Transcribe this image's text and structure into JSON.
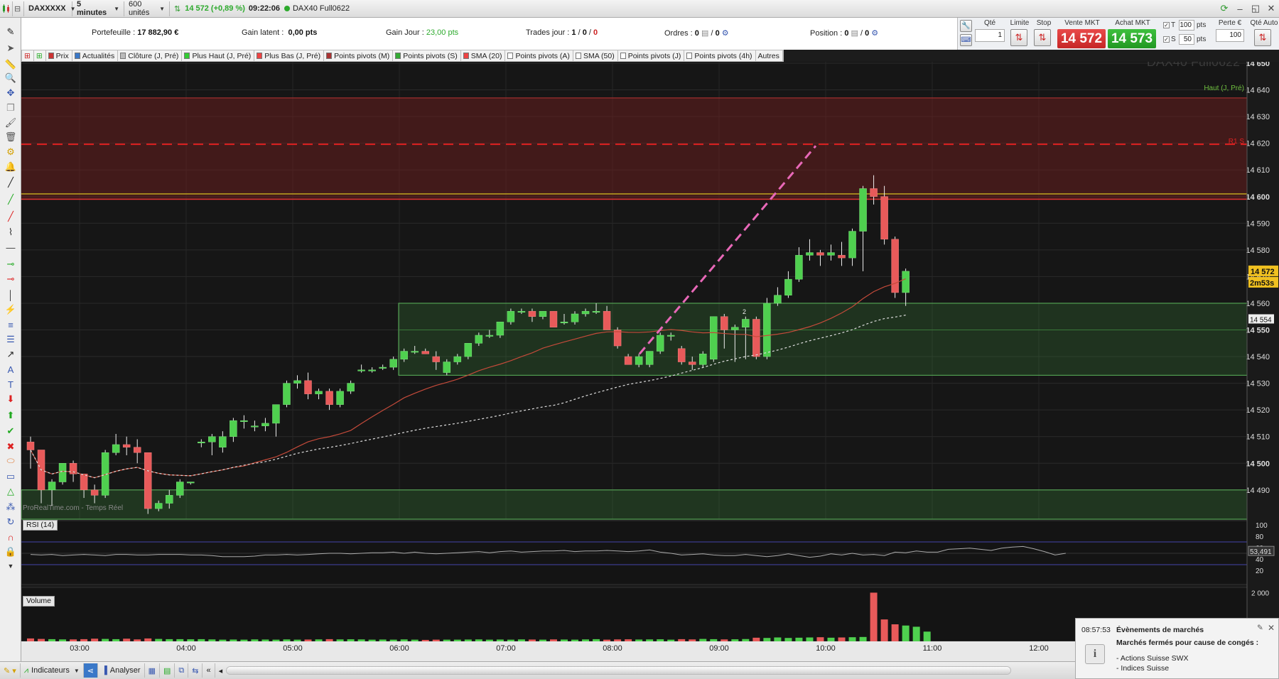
{
  "titlebar": {
    "instrument": "DAXXXXX",
    "timeframe": "5 minutes",
    "units": "600 unités",
    "price_change": "14 572 (+0,89 %)",
    "time": "09:22:06",
    "contract": "DAX40 Full0622"
  },
  "info": {
    "portfolio_label": "Portefeuille :",
    "portfolio_value": "17 882,90 €",
    "latent_label": "Gain latent :",
    "latent_value": "0,00 pts",
    "day_label": "Gain Jour :",
    "day_value": "23,00 pts",
    "trades_label": "Trades jour :",
    "trades_1": "1",
    "trades_2": "0",
    "trades_3": "0",
    "orders_label": "Ordres :",
    "orders_1": "0",
    "orders_2": "0",
    "position_label": "Position :",
    "position_1": "0",
    "position_2": "0"
  },
  "order_panel": {
    "qty_label": "Qté",
    "qty_value": "1",
    "limit_label": "Limite",
    "stop_label": "Stop",
    "sell_label": "Vente MKT",
    "sell_price": "14 572",
    "buy_label": "Achat MKT",
    "buy_price": "14 573",
    "t_label": "T",
    "t_value": "100",
    "s_label": "S",
    "s_value": "50",
    "pts": "pts",
    "loss_label": "Perte €",
    "loss_value": "100",
    "auto_label": "Qté Auto"
  },
  "indicators": [
    "Prix",
    "Actualités",
    "Clôture (J, Pré)",
    "Plus Haut (J, Pré)",
    "Plus Bas (J, Pré)",
    "Points pivots (M)",
    "Points pivots (S)",
    "SMA (20)",
    "Points pivots (A)",
    "SMA (50)",
    "Points pivots (J)",
    "Points pivots (4h)",
    "Autres"
  ],
  "chart": {
    "watermark": "DAX40 Full0622",
    "source": "ProRealTime.com - Temps Réel",
    "high_label": "Haut (J, Pré)",
    "r1_label": "R1 S",
    "price_tag": "14 572",
    "countdown": "2m53s",
    "sma_tag": "14 554",
    "rsi_label": "RSI (14)",
    "rsi_value": "53,491",
    "volume_label": "Volume",
    "marker": "2"
  },
  "chart_data": {
    "type": "candlestick",
    "x_tick_labels": [
      "03:00",
      "04:00",
      "05:00",
      "06:00",
      "07:00",
      "08:00",
      "09:00",
      "10:00",
      "11:00",
      "12:00"
    ],
    "y_tick_labels": [
      "14 650",
      "14 640",
      "14 630",
      "14 620",
      "14 610",
      "14 600",
      "14 590",
      "14 580",
      "14 570",
      "14 560",
      "14 550",
      "14 540",
      "14 530",
      "14 520",
      "14 510",
      "14 500",
      "14 490"
    ],
    "ylim": [
      14483,
      14655
    ],
    "rsi_tick_labels": [
      "100",
      "80",
      "60",
      "40",
      "20"
    ],
    "volume_tick_labels": [
      "2 000"
    ],
    "candles": [
      [
        14508,
        14510,
        14498,
        14505
      ],
      [
        14505,
        14505,
        14485,
        14490
      ],
      [
        14490,
        14494,
        14484,
        14493
      ],
      [
        14493,
        14500,
        14492,
        14500
      ],
      [
        14500,
        14501,
        14493,
        14496
      ],
      [
        14496,
        14496,
        14487,
        14490
      ],
      [
        14490,
        14492,
        14485,
        14488
      ],
      [
        14488,
        14505,
        14487,
        14504
      ],
      [
        14504,
        14511,
        14503,
        14507
      ],
      [
        14507,
        14510,
        14503,
        14506
      ],
      [
        14506,
        14509,
        14500,
        14504
      ],
      [
        14504,
        14504,
        14481,
        14483
      ],
      [
        14483,
        14486,
        14482,
        14485
      ],
      [
        14485,
        14490,
        14483,
        14488
      ],
      [
        14488,
        14494,
        14487,
        14493
      ],
      [
        14493,
        14493,
        14492,
        14493
      ],
      [
        14508,
        14509,
        14506,
        14508
      ],
      [
        14508,
        14511,
        14503,
        14510
      ],
      [
        14506,
        14512,
        14504,
        14510
      ],
      [
        14510,
        14517,
        14508,
        14516
      ],
      [
        14516,
        14518,
        14513,
        14516
      ],
      [
        14514,
        14516,
        14512,
        14514
      ],
      [
        14514,
        14517,
        14512,
        14515
      ],
      [
        14515,
        14522,
        14510,
        14522
      ],
      [
        14522,
        14531,
        14521,
        14530
      ],
      [
        14530,
        14533,
        14528,
        14531
      ],
      [
        14531,
        14534,
        14524,
        14526
      ],
      [
        14526,
        14528,
        14524,
        14527
      ],
      [
        14527,
        14528,
        14520,
        14522
      ],
      [
        14522,
        14528,
        14521,
        14527
      ],
      [
        14527,
        14531,
        14526,
        14530
      ],
      [
        14535,
        14537,
        14534,
        14535
      ],
      [
        14535,
        14536,
        14534,
        14535
      ],
      [
        14536,
        14537,
        14535,
        14536
      ],
      [
        14536,
        14540,
        14535,
        14539
      ],
      [
        14539,
        14543,
        14538,
        14542
      ],
      [
        14542,
        14544,
        14541,
        14542
      ],
      [
        14542,
        14543,
        14541,
        14541
      ],
      [
        14540,
        14542,
        14535,
        14538
      ],
      [
        14534,
        14539,
        14533,
        14538
      ],
      [
        14538,
        14541,
        14537,
        14540
      ],
      [
        14540,
        14545,
        14539,
        14545
      ],
      [
        14545,
        14549,
        14544,
        14548
      ],
      [
        14548,
        14550,
        14547,
        14548
      ],
      [
        14548,
        14553,
        14547,
        14553
      ],
      [
        14553,
        14558,
        14552,
        14557
      ],
      [
        14557,
        14558,
        14556,
        14557
      ],
      [
        14557,
        14558,
        14553,
        14555
      ],
      [
        14555,
        14557,
        14554,
        14557
      ],
      [
        14557,
        14557,
        14551,
        14551
      ],
      [
        14553,
        14556,
        14552,
        14553
      ],
      [
        14553,
        14557,
        14552,
        14556
      ],
      [
        14556,
        14558,
        14555,
        14557
      ],
      [
        14557,
        14560,
        14556,
        14557
      ],
      [
        14557,
        14559,
        14550,
        14550
      ],
      [
        14550,
        14551,
        14543,
        14544
      ],
      [
        14540,
        14541,
        14537,
        14537
      ],
      [
        14537,
        14541,
        14536,
        14540
      ],
      [
        14537,
        14542,
        14536,
        14542
      ],
      [
        14542,
        14549,
        14541,
        14548
      ],
      [
        14548,
        14549,
        14546,
        14548
      ],
      [
        14543,
        14544,
        14537,
        14538
      ],
      [
        14538,
        14540,
        14535,
        14537
      ],
      [
        14537,
        14542,
        14536,
        14541
      ],
      [
        14539,
        14555,
        14538,
        14555
      ],
      [
        14555,
        14556,
        14543,
        14550
      ],
      [
        14550,
        14552,
        14538,
        14551
      ],
      [
        14551,
        14555,
        14539,
        14554
      ],
      [
        14554,
        14555,
        14539,
        14540
      ],
      [
        14540,
        14562,
        14539,
        14560
      ],
      [
        14560,
        14566,
        14559,
        14563
      ],
      [
        14563,
        14572,
        14562,
        14569
      ],
      [
        14569,
        14581,
        14568,
        14578
      ],
      [
        14578,
        14584,
        14576,
        14579
      ],
      [
        14579,
        14580,
        14574,
        14578
      ],
      [
        14578,
        14582,
        14576,
        14579
      ],
      [
        14578,
        14583,
        14574,
        14577
      ],
      [
        14577,
        14588,
        14574,
        14587
      ],
      [
        14587,
        14604,
        14572,
        14603
      ],
      [
        14603,
        14608,
        14597,
        14600
      ],
      [
        14600,
        14604,
        14582,
        14584
      ],
      [
        14584,
        14585,
        14562,
        14564
      ],
      [
        14564,
        14573,
        14559,
        14572
      ]
    ],
    "rsi": [
      48,
      47,
      48,
      46,
      47,
      48,
      47,
      46,
      48,
      48,
      47,
      47,
      48,
      48,
      48,
      47,
      47,
      46,
      44,
      44,
      44,
      45,
      47,
      47,
      48,
      47,
      48,
      49,
      50,
      50,
      49,
      50,
      51,
      51,
      52,
      50,
      52,
      50,
      49,
      50,
      51,
      52,
      53,
      51,
      53,
      54,
      52,
      53,
      54,
      54,
      55,
      53,
      54,
      54,
      55,
      54,
      53,
      54,
      56,
      52,
      50,
      47,
      48,
      49,
      47,
      46,
      46,
      48,
      46,
      44,
      46,
      49,
      46,
      43,
      45,
      49,
      47,
      50,
      47,
      48,
      46,
      52,
      51,
      54,
      52,
      52,
      57,
      58,
      59,
      57,
      55,
      59,
      61,
      62,
      58,
      53,
      47,
      50
    ],
    "volume": [
      120,
      100,
      90,
      80,
      80,
      90,
      110,
      100,
      90,
      110,
      80,
      120,
      100,
      90,
      90,
      85,
      90,
      80,
      70,
      75,
      70,
      80,
      75,
      70,
      80,
      70,
      75,
      80,
      90,
      80,
      85,
      80,
      70,
      75,
      70,
      80,
      70,
      60,
      70,
      70,
      70,
      75,
      80,
      70,
      75,
      70,
      80,
      75,
      70,
      80,
      75,
      70,
      80,
      90,
      70,
      80,
      85,
      75,
      80,
      85,
      70,
      90,
      80,
      100,
      90,
      80,
      85,
      95,
      150,
      140,
      160,
      140,
      150,
      160,
      170,
      150,
      160,
      170,
      180,
      2000,
      900,
      700,
      650,
      600,
      400
    ]
  },
  "bottombar": {
    "indicators": "Indicateurs",
    "analyze": "Analyser"
  },
  "notification": {
    "time": "08:57:53",
    "title": "Évènements de marchés",
    "heading": "Marchés fermés pour cause de congés :",
    "line1": "- Actions Suisse SWX",
    "line2": "- Indices Suisse"
  }
}
